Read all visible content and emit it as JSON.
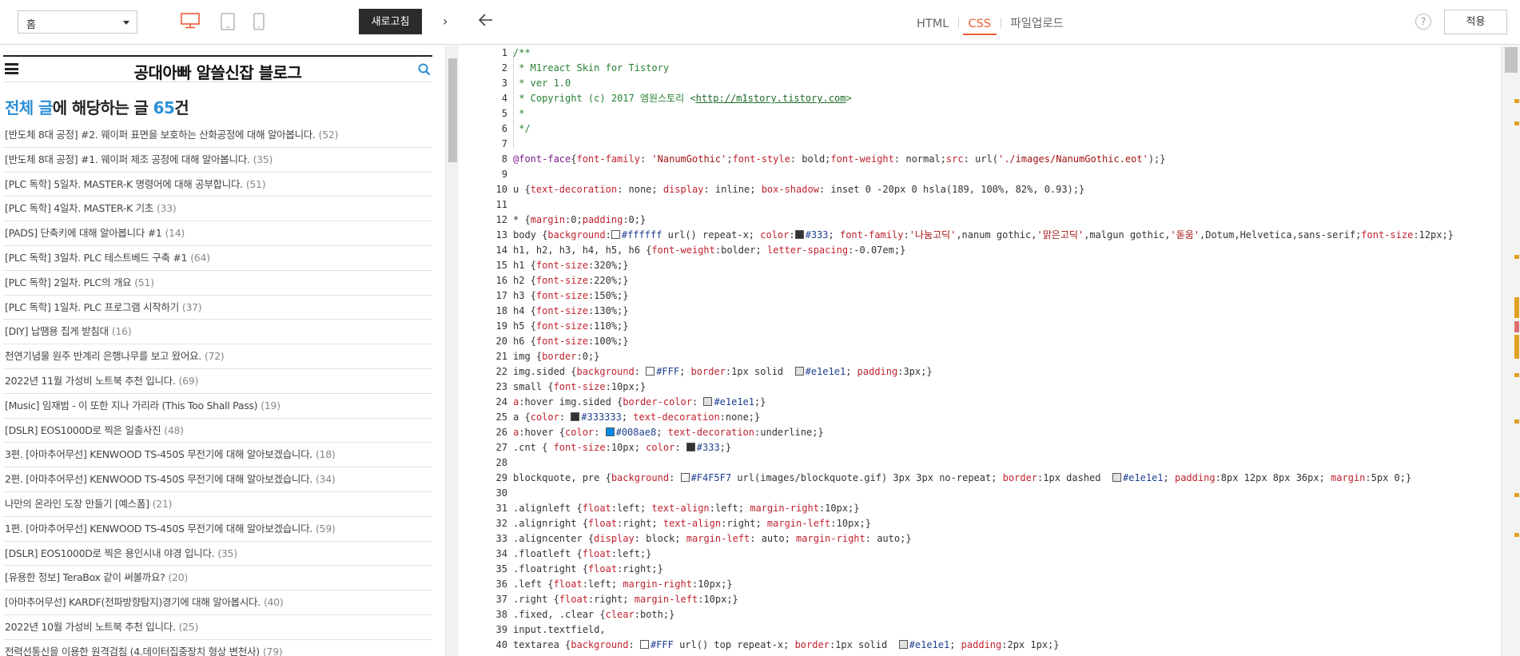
{
  "left_toolbar": {
    "page_select_value": "홈",
    "refresh_label": "새로고침",
    "collapse_glyph": "›"
  },
  "blog": {
    "title": "공대아빠 알쓸신잡 블로그",
    "heading_prefix": "전체 글",
    "heading_middle": "에 해당하는 글 ",
    "heading_count": "65",
    "heading_suffix": "건",
    "posts": [
      {
        "title": "[반도체 8대 공정] #2. 웨이퍼 표면을 보호하는 산화공정에 대해 알아봅니다.",
        "count": "(52)"
      },
      {
        "title": "[반도체 8대 공정] #1. 웨이퍼 제조 공정에 대해 알아봅니다.",
        "count": "(35)"
      },
      {
        "title": "[PLC 독학] 5일차. MASTER-K 명령어에 대해 공부합니다.",
        "count": "(51)"
      },
      {
        "title": "[PLC 독학] 4일차. MASTER-K 기초",
        "count": "(33)"
      },
      {
        "title": "[PADS] 단축키에 대해 알아봅니다 #1",
        "count": "(14)"
      },
      {
        "title": "[PLC 독학] 3일차. PLC 테스트베드 구축 #1",
        "count": "(64)"
      },
      {
        "title": "[PLC 독학] 2일차. PLC의 개요",
        "count": "(51)"
      },
      {
        "title": "[PLC 독학] 1일차. PLC 프로그램 시작하기",
        "count": "(37)"
      },
      {
        "title": "[DIY] 납땜용 집게 받침대",
        "count": "(16)"
      },
      {
        "title": "천연기념물 원주 반계리 은행나무를 보고 왔어요.",
        "count": "(72)"
      },
      {
        "title": "2022년 11월 가성비 노트북 추천 입니다.",
        "count": "(69)"
      },
      {
        "title": "[Music] 임재범 - 이 또한 지나 가리라 (This Too Shall Pass)",
        "count": "(19)"
      },
      {
        "title": "[DSLR] EOS1000D로 찍은 일출사진",
        "count": "(48)"
      },
      {
        "title": "3편. [아마추어무선] KENWOOD TS-450S 무전기에 대해 알아보겠습니다.",
        "count": "(18)"
      },
      {
        "title": "2편. [아마추어무선] KENWOOD TS-450S 무전기에 대해 알아보겠습니다.",
        "count": "(34)"
      },
      {
        "title": "나만의 온라인 도장 만들기 [예스폼]",
        "count": "(21)"
      },
      {
        "title": "1편. [아마추어무선] KENWOOD TS-450S 무전기에 대해 알아보겠습니다.",
        "count": "(59)"
      },
      {
        "title": "[DSLR] EOS1000D로 찍은 용인시내 야경 입니다.",
        "count": "(35)"
      },
      {
        "title": "[유용한 정보] TeraBox 같이 써볼까요?",
        "count": "(20)"
      },
      {
        "title": "[아마추어무선] KARDF(전파방향탐지)경기에 대해 알아봅시다.",
        "count": "(40)"
      },
      {
        "title": "2022년 10월 가성비 노트북 추천 입니다.",
        "count": "(25)"
      },
      {
        "title": "전력선통신을 이용한 원격검침 (4.데이터집중장치 형상 변천사)",
        "count": "(79)"
      }
    ]
  },
  "editor": {
    "tabs": [
      "HTML",
      "CSS",
      "파일업로드"
    ],
    "active_tab": "CSS",
    "help_label": "?",
    "apply_label": "적용",
    "line_numbers": [
      "1",
      "2",
      "3",
      "4",
      "5",
      "6",
      "7",
      "8",
      "9",
      "10",
      "11",
      "12",
      "13",
      "14",
      "15",
      "16",
      "17",
      "18",
      "19",
      "20",
      "21",
      "22",
      "23",
      "24",
      "25",
      "26",
      "27",
      "28",
      "29",
      "30",
      "31",
      "32",
      "33",
      "34",
      "35",
      "36",
      "37",
      "38",
      "39",
      "40"
    ],
    "code_lines": [
      "/**",
      " * M1react Skin for Tistory",
      " * ver 1.0",
      " * Copyright (c) 2017 엠원스토리 <http://m1story.tistory.com>",
      " *",
      " */",
      "",
      "@font-face{font-family: 'NanumGothic';font-style: bold;font-weight: normal;src: url('./images/NanumGothic.eot');}",
      "",
      "u {text-decoration: none; display: inline; box-shadow: inset 0 -20px 0 hsla(189, 100%, 82%, 0.93);}",
      "",
      "* {margin:0;padding:0;}",
      "body {background:#ffffff url() repeat-x; color:#333; font-family:'나눔고딕',nanum gothic,'맑은고딕',malgun gothic,'돋움',Dotum,Helvetica,sans-serif;font-size:12px;}",
      "h1, h2, h3, h4, h5, h6 {font-weight:bolder; letter-spacing:-0.07em;}",
      "h1 {font-size:320%;}",
      "h2 {font-size:220%;}",
      "h3 {font-size:150%;}",
      "h4 {font-size:130%;}",
      "h5 {font-size:110%;}",
      "h6 {font-size:100%;}",
      "img {border:0;}",
      "img.sided {background: #FFF; border:1px solid  #e1e1e1; padding:3px;}",
      "small {font-size:10px;}",
      "a:hover img.sided {border-color: #e1e1e1;}",
      "a {color: #333333; text-decoration:none;}",
      "a:hover {color: #008ae8; text-decoration:underline;}",
      ".cnt { font-size:10px; color: #333;}",
      "",
      "blockquote, pre {background: #F4F5F7 url(images/blockquote.gif) 3px 3px no-repeat; border:1px dashed  #e1e1e1; padding:8px 12px 8px 36px; margin:5px 0;}",
      "",
      ".alignleft {float:left; text-align:left; margin-right:10px;}",
      ".alignright {float:right; text-align:right; margin-left:10px;}",
      ".aligncenter {display: block; margin-left: auto; margin-right: auto;}",
      ".floatleft {float:left;}",
      ".floatright {float:right;}",
      ".left {float:left; margin-right:10px;}",
      ".right {float:right; margin-left:10px;}",
      ".fixed, .clear {clear:both;}",
      "input.textfield,",
      "textarea {background: #FFF url() top repeat-x; border:1px solid  #e1e1e1; padding:2px 1px;}"
    ]
  },
  "colors": {
    "accent_blue": "#2d8fd6",
    "active_tab": "#ef5b34",
    "refresh_bg": "#2b2b2b"
  },
  "icons": [
    "pc-icon",
    "tablet-icon",
    "mobile-icon",
    "hamburger-icon",
    "search-icon",
    "back-arrow-icon",
    "collapse-chevron-icon"
  ]
}
